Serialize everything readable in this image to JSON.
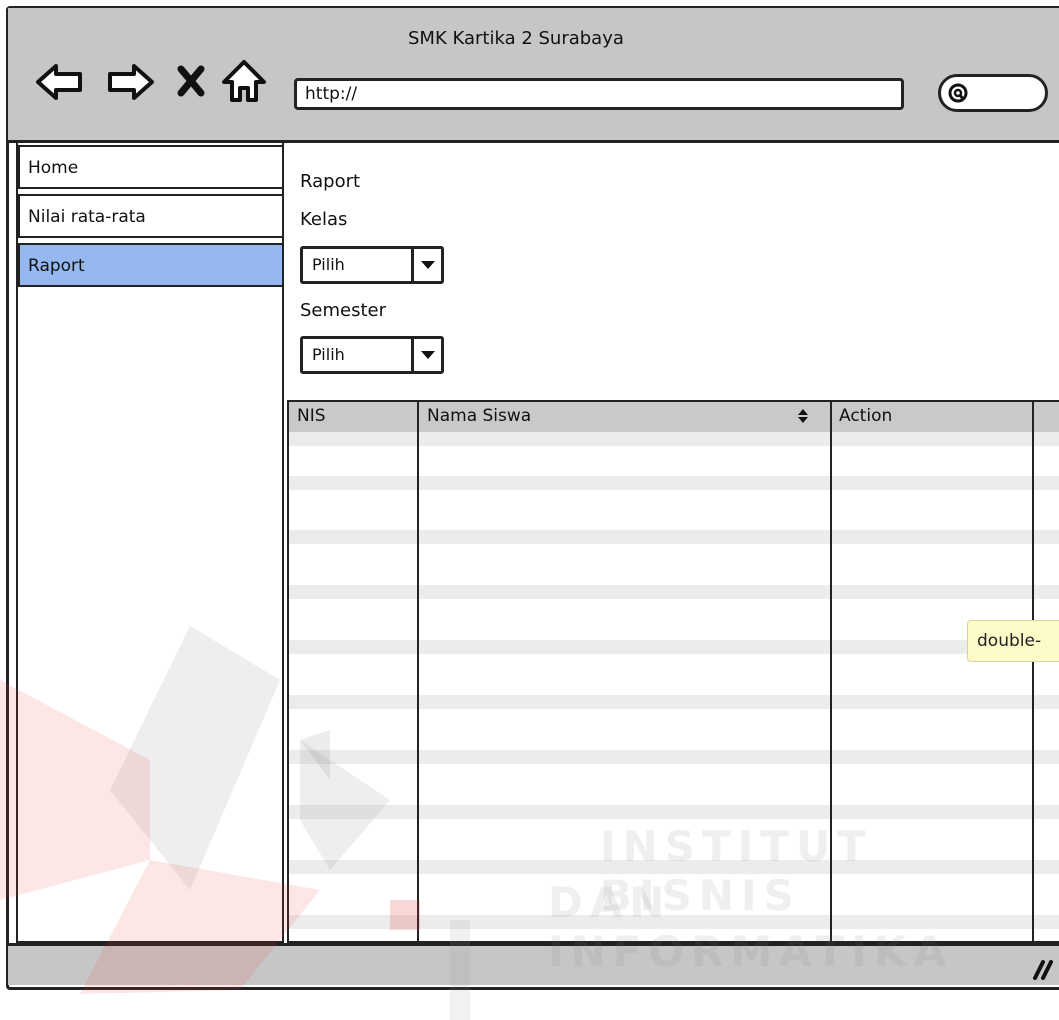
{
  "window": {
    "title": "SMK Kartika 2 Surabaya"
  },
  "toolbar": {
    "back_icon": "back-arrow-icon",
    "forward_icon": "forward-arrow-icon",
    "stop_icon": "close-icon",
    "home_icon": "home-icon",
    "url_value": "http://",
    "search_icon": "search-icon"
  },
  "sidebar": {
    "items": [
      {
        "label": "Home",
        "active": false
      },
      {
        "label": "Nilai rata-rata",
        "active": false
      },
      {
        "label": "Raport",
        "active": true
      }
    ]
  },
  "main": {
    "heading": "Raport",
    "kelas_label": "Kelas",
    "kelas_value": "Pilih",
    "semester_label": "Semester",
    "semester_value": "Pilih"
  },
  "table": {
    "columns": [
      "NIS",
      "Nama Siswa",
      "Action"
    ],
    "sort_icon": "sort-icon",
    "rows": []
  },
  "tooltip": {
    "text": "double-"
  },
  "watermark": {
    "line1": "INSTITUT BISNIS",
    "line2": "DAN INFORMATIKA"
  },
  "colors": {
    "chrome": "#c6c6c6",
    "active_item": "#95b8ee",
    "tooltip": "#fdfbc8"
  }
}
